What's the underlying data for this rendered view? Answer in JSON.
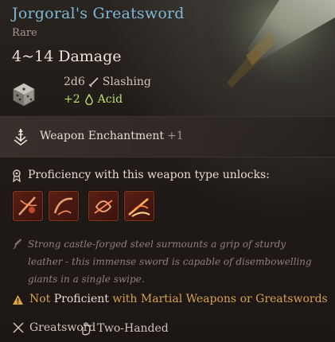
{
  "item": {
    "name": "Jorgoral's Greatsword",
    "rarity": "Rare",
    "damage_range": "4~14 Damage",
    "damage_primary": {
      "dice": "2d6",
      "type": "Slashing"
    },
    "damage_bonus": {
      "amount": "+2",
      "type": "Acid"
    }
  },
  "enchantment": {
    "label": "Weapon Enchantment",
    "bonus": "+1"
  },
  "proficiency": {
    "header": "Proficiency with this weapon type unlocks:",
    "actions": [
      "action-1-icon",
      "action-2-icon",
      "action-3-icon",
      "action-4-icon"
    ]
  },
  "lore": "Strong castle-forged steel surmounts a grip of sturdy leather - this immense sword is capable of disembowelling giants in a single swipe.",
  "warning": {
    "not": "Not",
    "proficient": "Proficient",
    "requirement": "with Martial Weapons or Greatswords"
  },
  "tags": {
    "weapon_type": "Greatsword",
    "handedness": "Two-Handed"
  },
  "colors": {
    "title": "#7fb7d6",
    "acid": "#b8e06a",
    "warning": "#d4a24e",
    "background": "#1c1714"
  }
}
